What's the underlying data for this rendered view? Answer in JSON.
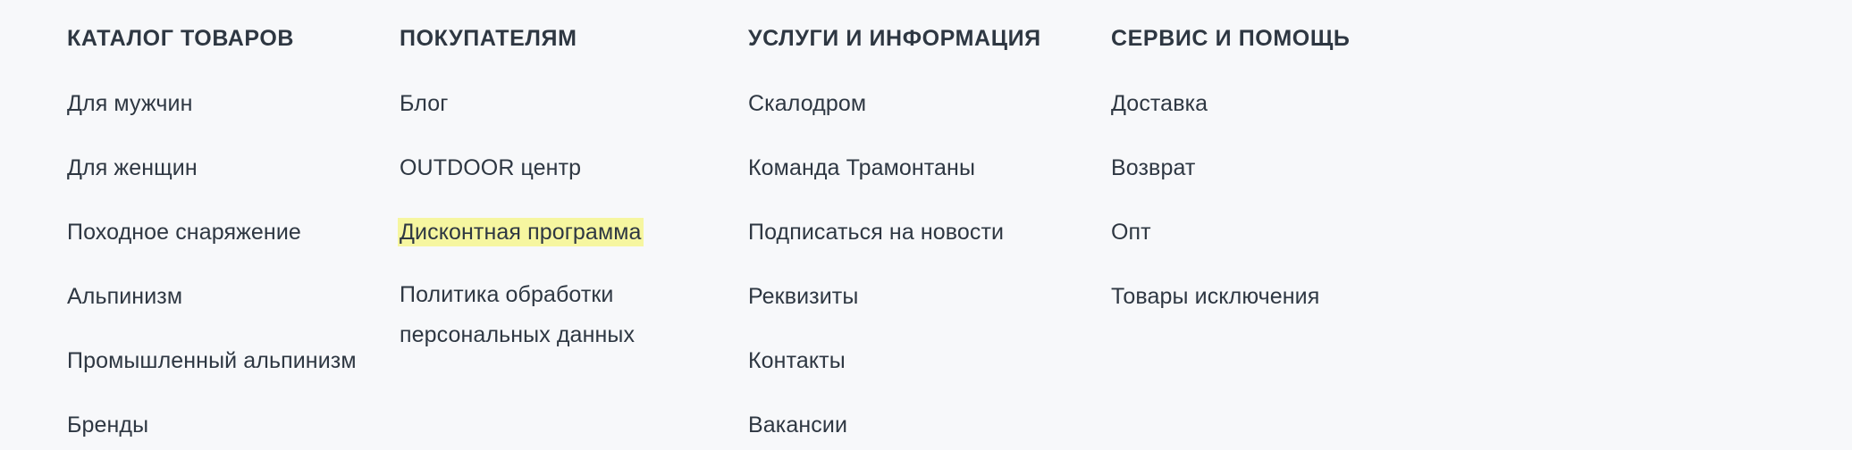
{
  "footer": {
    "background_color": "#f7f8fa",
    "text_color": "#2e3742",
    "highlight_color": "#f6f6a0",
    "columns": [
      {
        "title": "КАТАЛОГ ТОВАРОВ",
        "items": [
          {
            "label": "Для мужчин",
            "highlighted": false
          },
          {
            "label": "Для женщин",
            "highlighted": false
          },
          {
            "label": "Походное снаряжение",
            "highlighted": false
          },
          {
            "label": "Альпинизм",
            "highlighted": false
          },
          {
            "label": "Промышленный альпинизм",
            "highlighted": false
          },
          {
            "label": "Бренды",
            "highlighted": false
          }
        ]
      },
      {
        "title": "ПОКУПАТЕЛЯМ",
        "items": [
          {
            "label": "Блог",
            "highlighted": false
          },
          {
            "label": "OUTDOOR центр",
            "highlighted": false
          },
          {
            "label": "Дисконтная программа",
            "highlighted": true
          },
          {
            "label": "Политика обработки персональных данных",
            "highlighted": false
          }
        ]
      },
      {
        "title": "УСЛУГИ И ИНФОРМАЦИЯ",
        "items": [
          {
            "label": "Скалодром",
            "highlighted": false
          },
          {
            "label": "Команда Трамонтаны",
            "highlighted": false
          },
          {
            "label": "Подписаться на новости",
            "highlighted": false
          },
          {
            "label": "Реквизиты",
            "highlighted": false
          },
          {
            "label": "Контакты",
            "highlighted": false
          },
          {
            "label": "Вакансии",
            "highlighted": false
          }
        ]
      },
      {
        "title": "СЕРВИС И ПОМОЩЬ",
        "items": [
          {
            "label": "Доставка",
            "highlighted": false
          },
          {
            "label": "Возврат",
            "highlighted": false
          },
          {
            "label": "Опт",
            "highlighted": false
          },
          {
            "label": "Товары исключения",
            "highlighted": false
          }
        ]
      }
    ]
  }
}
